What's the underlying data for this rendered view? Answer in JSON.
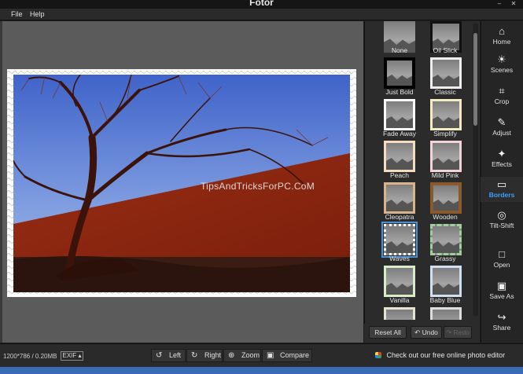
{
  "window": {
    "title": "Fotor",
    "min_glyph": "–"
  },
  "menu": {
    "items": [
      "File",
      "Help"
    ]
  },
  "canvas": {
    "watermark": "TipsAndTricksForPC.CoM"
  },
  "borders": [
    {
      "label": "None"
    },
    {
      "label": "Oil Slick"
    },
    {
      "label": "Just Bold"
    },
    {
      "label": "Classic"
    },
    {
      "label": "Fade Away"
    },
    {
      "label": "Simplify"
    },
    {
      "label": "Peach"
    },
    {
      "label": "Mild Pink"
    },
    {
      "label": "Cleopatra"
    },
    {
      "label": "Wooden"
    },
    {
      "label": "Waves",
      "selected": true
    },
    {
      "label": "Grassy"
    },
    {
      "label": "Vanilla"
    },
    {
      "label": "Baby Blue"
    }
  ],
  "panel_actions": {
    "reset": "Reset All",
    "undo": "Undo",
    "redo": "Redo"
  },
  "sidebar": [
    {
      "label": "Home",
      "icon": "home-icon",
      "glyph": "⌂"
    },
    {
      "label": "Scenes",
      "icon": "sun-icon",
      "glyph": "☀"
    },
    {
      "label": "Crop",
      "icon": "crop-icon",
      "glyph": "⌗"
    },
    {
      "label": "Adjust",
      "icon": "pencil-icon",
      "glyph": "✎"
    },
    {
      "label": "Effects",
      "icon": "sparkle-icon",
      "glyph": "✦"
    },
    {
      "label": "Borders",
      "icon": "border-frame-icon",
      "glyph": "▭",
      "active": true
    },
    {
      "label": "Tilt-Shift",
      "icon": "target-icon",
      "glyph": "◎"
    },
    {
      "label": "Open",
      "icon": "document-icon",
      "glyph": "□"
    },
    {
      "label": "Save As",
      "icon": "floppy-icon",
      "glyph": "▣"
    },
    {
      "label": "Share",
      "icon": "share-icon",
      "glyph": "↪"
    }
  ],
  "status": {
    "image_info": "1200*786 / 0.20MB",
    "exif": "EXIF ▴",
    "left": "Left",
    "right": "Right",
    "zoom": "Zoom",
    "compare": "Compare",
    "promo": "Check out our free online photo editor"
  },
  "colors": {
    "accent": "#39a0ff",
    "selection": "#4a90d9",
    "panel_bg": "#2b2b2b",
    "canvas_bg": "#5b5b5b",
    "taskbar": "#3a6bb5"
  }
}
